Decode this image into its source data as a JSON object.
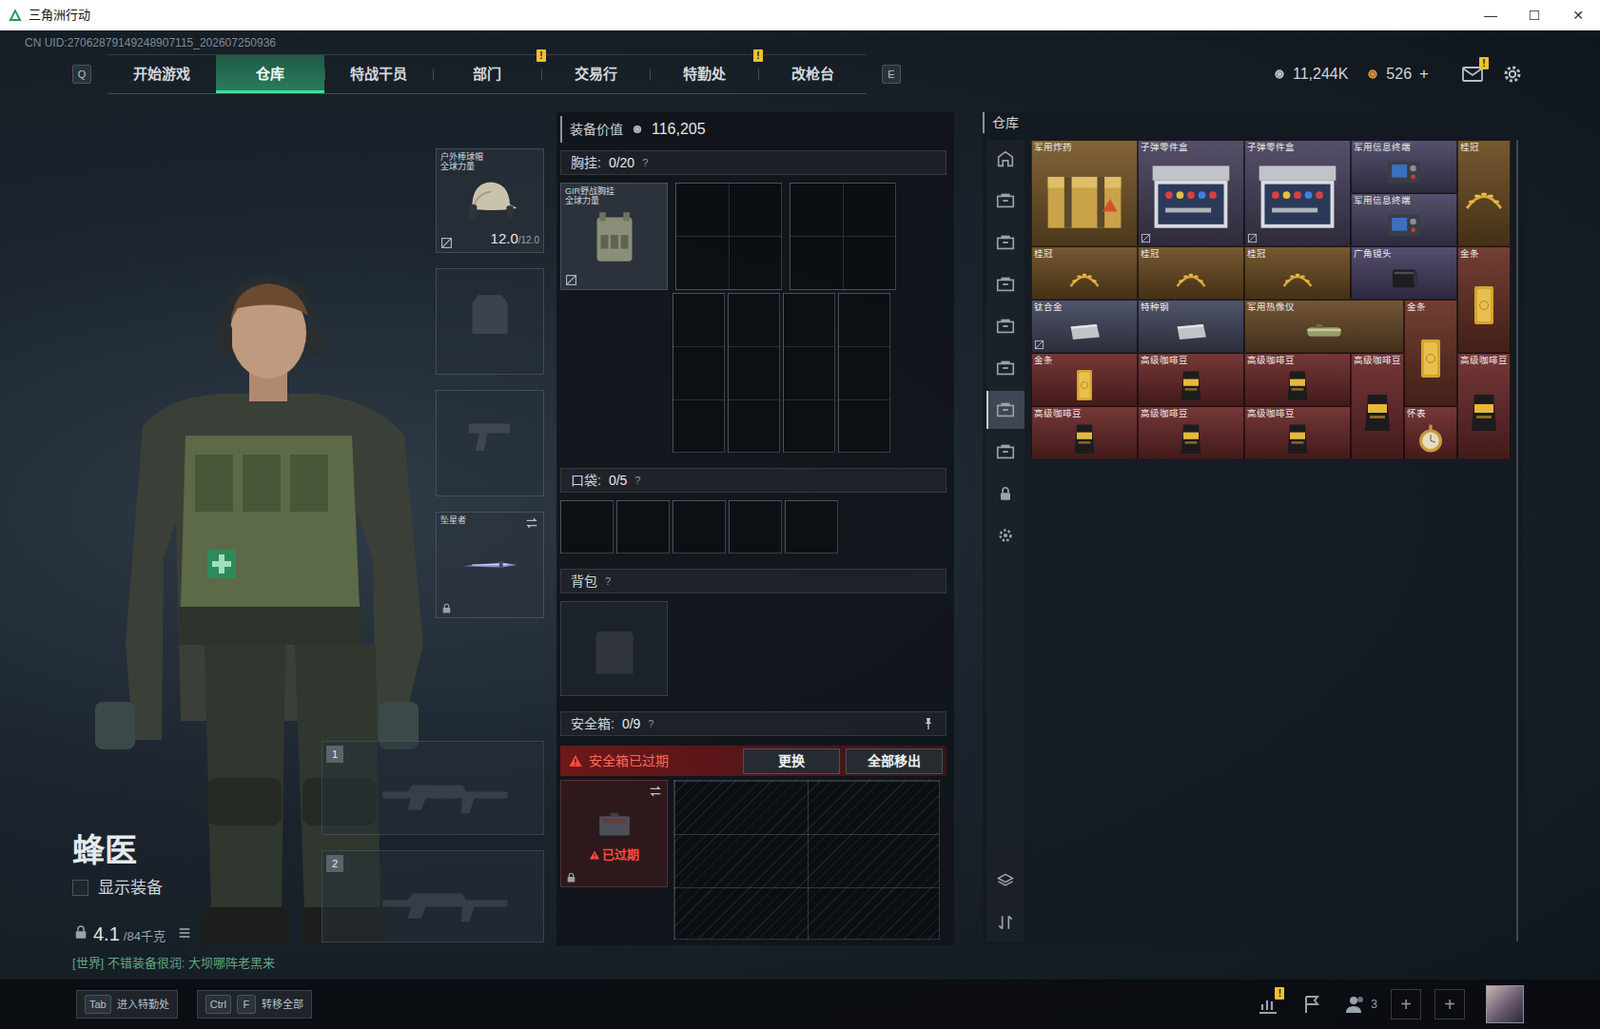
{
  "window": {
    "title": "三角洲行动",
    "controls": [
      "—",
      "☐",
      "✕"
    ]
  },
  "uid": "CN UID:27062879149248907115_202607250936",
  "nav": {
    "prev_key": "Q",
    "next_key": "E",
    "tabs": [
      {
        "label": "开始游戏",
        "selected": false,
        "badge": ""
      },
      {
        "label": "仓库",
        "selected": true,
        "badge": ""
      },
      {
        "label": "特战干员",
        "selected": false,
        "badge": ""
      },
      {
        "label": "部门",
        "selected": false,
        "badge": "!"
      },
      {
        "label": "交易行",
        "selected": false,
        "badge": ""
      },
      {
        "label": "特勤处",
        "selected": false,
        "badge": "!"
      },
      {
        "label": "改枪台",
        "selected": false,
        "badge": ""
      }
    ]
  },
  "currencies": [
    {
      "amount": "11,244K",
      "plus": "",
      "color": "#b9c0c8"
    },
    {
      "amount": "526",
      "plus": "+",
      "color": "#d9913c"
    }
  ],
  "mail": {
    "badge": "!"
  },
  "operator": {
    "name": "蜂医",
    "show_gear": {
      "label": "显示装备",
      "checked": false
    },
    "weight": "4.1",
    "capacity": "/84千克",
    "chat": "[世界] 不错装备很润: 大坝哪阵老黑来"
  },
  "gear_slots": [
    {
      "kind": "helmet",
      "filled": true,
      "name": "户外棒球帽",
      "tag": "全球力量",
      "durability": "12.0",
      "max": "/12.0",
      "insured": false,
      "locked": false,
      "swappable": false
    },
    {
      "kind": "armor",
      "filled": false,
      "name": "",
      "tag": "",
      "durability": "",
      "max": "",
      "insured": true,
      "locked": false,
      "swappable": false
    },
    {
      "kind": "pistol",
      "filled": false,
      "name": "",
      "tag": "",
      "durability": "",
      "max": "",
      "insured": true,
      "locked": false,
      "swappable": false
    },
    {
      "kind": "melee",
      "filled": true,
      "name": "坠星者",
      "tag": "",
      "durability": "",
      "max": "",
      "insured": true,
      "locked": true,
      "swappable": true
    }
  ],
  "weapon_slots": [
    {
      "number": "1"
    },
    {
      "number": "2"
    }
  ],
  "loadout": {
    "value": {
      "label": "装备价值",
      "amount": "116,205"
    },
    "chest": {
      "label": "胸挂:",
      "count": "0/20",
      "help": "?",
      "item": {
        "name": "GIR野战胸挂",
        "tag": "全球力量",
        "insured": false
      }
    },
    "pockets": {
      "label": "口袋:",
      "count": "0/5",
      "help": "?",
      "slots": 5
    },
    "backpack": {
      "label": "背包",
      "help": "?"
    },
    "safebox": {
      "label": "安全箱:",
      "count": "0/9",
      "help": "?",
      "pinned": true,
      "expired": true,
      "warning": "安全箱已过期",
      "buttons": [
        "更换",
        "全部移出"
      ],
      "case": {
        "status": "已过期",
        "locked": true,
        "swappable": true
      }
    }
  },
  "warehouse": {
    "title": "仓库",
    "tabs": [
      {
        "kind": "outpost",
        "selected": false
      },
      {
        "kind": "storage",
        "selected": false
      },
      {
        "kind": "storage",
        "selected": false
      },
      {
        "kind": "storage",
        "selected": false
      },
      {
        "kind": "storage",
        "selected": false
      },
      {
        "kind": "storage",
        "selected": false
      },
      {
        "kind": "storage",
        "selected": true
      },
      {
        "kind": "storage",
        "selected": false
      }
    ],
    "tools": [
      {
        "kind": "lock"
      },
      {
        "kind": "gear"
      },
      {
        "kind": "layers"
      },
      {
        "kind": "sort"
      }
    ],
    "items": [
      {
        "label": "军用炸药",
        "kind": "explosive",
        "color": "#7a5a2c",
        "bound": false
      },
      {
        "label": "子弹零件盒",
        "kind": "parts",
        "color": "#4b4460",
        "bound": true
      },
      {
        "label": "子弹零件盒",
        "kind": "parts",
        "color": "#4b4460",
        "bound": true
      },
      {
        "label": "军用信息终端",
        "kind": "terminal",
        "color": "#4a4664",
        "bound": false
      },
      {
        "label": "军用信息终端",
        "kind": "terminal",
        "color": "#4a4664",
        "bound": false
      },
      {
        "label": "桂冠",
        "kind": "laurel",
        "color": "#6e4e24",
        "bound": false
      },
      {
        "label": "桂冠",
        "kind": "laurel",
        "color": "#6e4e24",
        "bound": false
      },
      {
        "label": "桂冠",
        "kind": "laurel",
        "color": "#6e4e24",
        "bound": false
      },
      {
        "label": "桂冠",
        "kind": "laurel",
        "color": "#6e4e24",
        "bound": false
      },
      {
        "label": "广角镜头",
        "kind": "lens",
        "color": "#4a4266",
        "bound": false
      },
      {
        "label": "金条",
        "kind": "gold",
        "color": "#6a3326",
        "bound": false
      },
      {
        "label": "钛合金",
        "kind": "ingot",
        "color": "#454a60",
        "bound": true
      },
      {
        "label": "特种钢",
        "kind": "ingot",
        "color": "#454a60",
        "bound": false
      },
      {
        "label": "军用热像仪",
        "kind": "scope",
        "color": "#6a4c2a",
        "bound": false
      },
      {
        "label": "金条",
        "kind": "gold",
        "color": "#6a3326",
        "bound": false
      },
      {
        "label": "金条",
        "kind": "gold",
        "color": "#6d2b2b",
        "bound": false
      },
      {
        "label": "高级咖啡豆",
        "kind": "coffee",
        "color": "#6d2b2b",
        "bound": false
      },
      {
        "label": "高级咖啡豆",
        "kind": "coffee",
        "color": "#6d2b2b",
        "bound": false
      },
      {
        "label": "高级咖啡豆",
        "kind": "coffee",
        "color": "#6d2b2b",
        "bound": false
      },
      {
        "label": "高级咖啡豆",
        "kind": "coffee",
        "color": "#6d2b2b",
        "bound": false
      },
      {
        "label": "高级咖啡豆",
        "kind": "coffee",
        "color": "#6d2b2b",
        "bound": false
      },
      {
        "label": "高级咖啡豆",
        "kind": "coffee",
        "color": "#6d2b2b",
        "bound": false
      },
      {
        "label": "高级咖啡豆",
        "kind": "coffee",
        "color": "#6d2b2b",
        "bound": false
      },
      {
        "label": "怀表",
        "kind": "watch",
        "color": "#6d2b2b",
        "bound": false
      }
    ]
  },
  "bottom": {
    "hints": [
      {
        "keys": [
          "Tab"
        ],
        "label": "进入特勤处"
      },
      {
        "keys": [
          "Ctrl",
          "F"
        ],
        "label": "转移全部"
      }
    ],
    "stats_badge": "!",
    "friends": "3",
    "slots": [
      "+",
      "+"
    ]
  }
}
